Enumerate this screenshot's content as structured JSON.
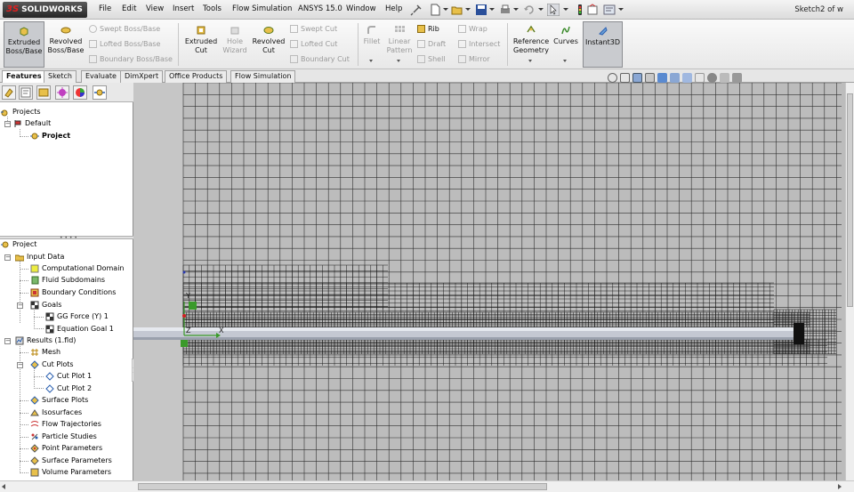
{
  "app": {
    "logo": "SOLIDWORKS",
    "logo_mark": "3S",
    "doc_title": "Sketch2 of w"
  },
  "menu": [
    "File",
    "Edit",
    "View",
    "Insert",
    "Tools",
    "Flow Simulation",
    "ANSYS 15.0",
    "Window",
    "Help"
  ],
  "ribbon": {
    "extruded_boss": "Extruded\nBoss/Base",
    "revolved_boss": "Revolved\nBoss/Base",
    "swept_boss": "Swept Boss/Base",
    "lofted_boss": "Lofted Boss/Base",
    "boundary_boss": "Boundary Boss/Base",
    "extruded_cut": "Extruded\nCut",
    "hole_wizard": "Hole\nWizard",
    "revolved_cut": "Revolved\nCut",
    "swept_cut": "Swept Cut",
    "lofted_cut": "Lofted Cut",
    "boundary_cut": "Boundary Cut",
    "fillet": "Fillet",
    "linear_pattern": "Linear\nPattern",
    "rib": "Rib",
    "draft": "Draft",
    "shell": "Shell",
    "wrap": "Wrap",
    "intersect": "Intersect",
    "mirror": "Mirror",
    "reference_geometry": "Reference\nGeometry",
    "curves": "Curves",
    "instant3d": "Instant3D"
  },
  "tabs": [
    "Features",
    "Sketch",
    "Evaluate",
    "DimXpert",
    "Office Products",
    "Flow Simulation"
  ],
  "active_tab": "Features",
  "upper_tree": {
    "root": "Projects",
    "default": "Default",
    "project": "Project"
  },
  "lower_tree": {
    "project": "Project",
    "input_data": "Input Data",
    "computational_domain": "Computational Domain",
    "fluid_subdomains": "Fluid Subdomains",
    "boundary_conditions": "Boundary Conditions",
    "goals": "Goals",
    "goal_1": "GG Force (Y) 1",
    "goal_2": "Equation Goal 1",
    "results": "Results (1.fld)",
    "mesh": "Mesh",
    "cut_plots": "Cut Plots",
    "cut_plot_1": "Cut Plot 1",
    "cut_plot_2": "Cut Plot 2",
    "surface_plots": "Surface Plots",
    "isosurfaces": "Isosurfaces",
    "flow_trajectories": "Flow Trajectories",
    "particle_studies": "Particle Studies",
    "point_parameters": "Point Parameters",
    "surface_parameters": "Surface Parameters",
    "volume_parameters": "Volume Parameters"
  },
  "triad": {
    "x": "X",
    "y": "Y",
    "z": "Z"
  },
  "colors": {
    "accent_blue": "#2a5fb0",
    "mesh_line": "#333333",
    "viewport_bg": "#bcbcbc"
  }
}
